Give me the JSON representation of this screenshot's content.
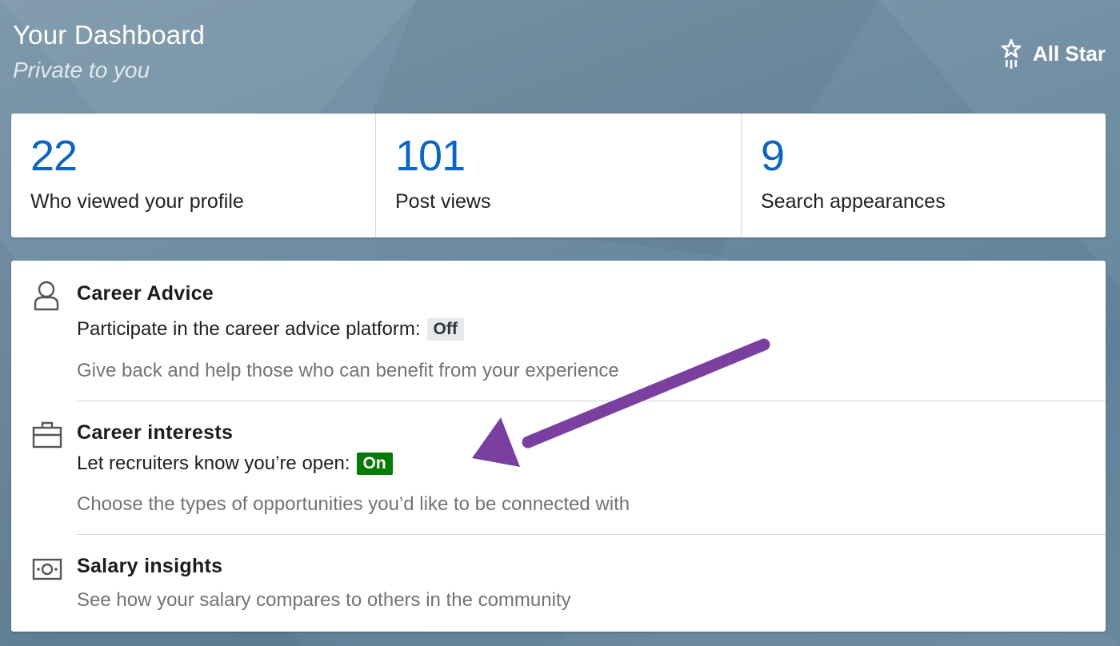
{
  "header": {
    "title": "Your Dashboard",
    "subtitle": "Private to you",
    "badge_label": "All Star",
    "badge_icon": "all-star-icon"
  },
  "stats": [
    {
      "value": "22",
      "label": "Who viewed your profile"
    },
    {
      "value": "101",
      "label": "Post views"
    },
    {
      "value": "9",
      "label": "Search appearances"
    }
  ],
  "sections": [
    {
      "icon": "person-icon",
      "title": "Career Advice",
      "setting": "Participate in the career advice platform:",
      "status": "Off",
      "description": "Give back and help those who can benefit from your experience"
    },
    {
      "icon": "briefcase-icon",
      "title": "Career interests",
      "setting": "Let recruiters know you’re open:",
      "status": "On",
      "description": "Choose the types of opportunities you’d like to be connected with"
    },
    {
      "icon": "money-icon",
      "title": "Salary insights",
      "description": "See how your salary compares to others in the community"
    }
  ],
  "colors": {
    "accent": "#0a66c2",
    "status_on": "#057a05",
    "status_off_bg": "#e6e9ec",
    "annotation_arrow": "#7b3fa0"
  }
}
